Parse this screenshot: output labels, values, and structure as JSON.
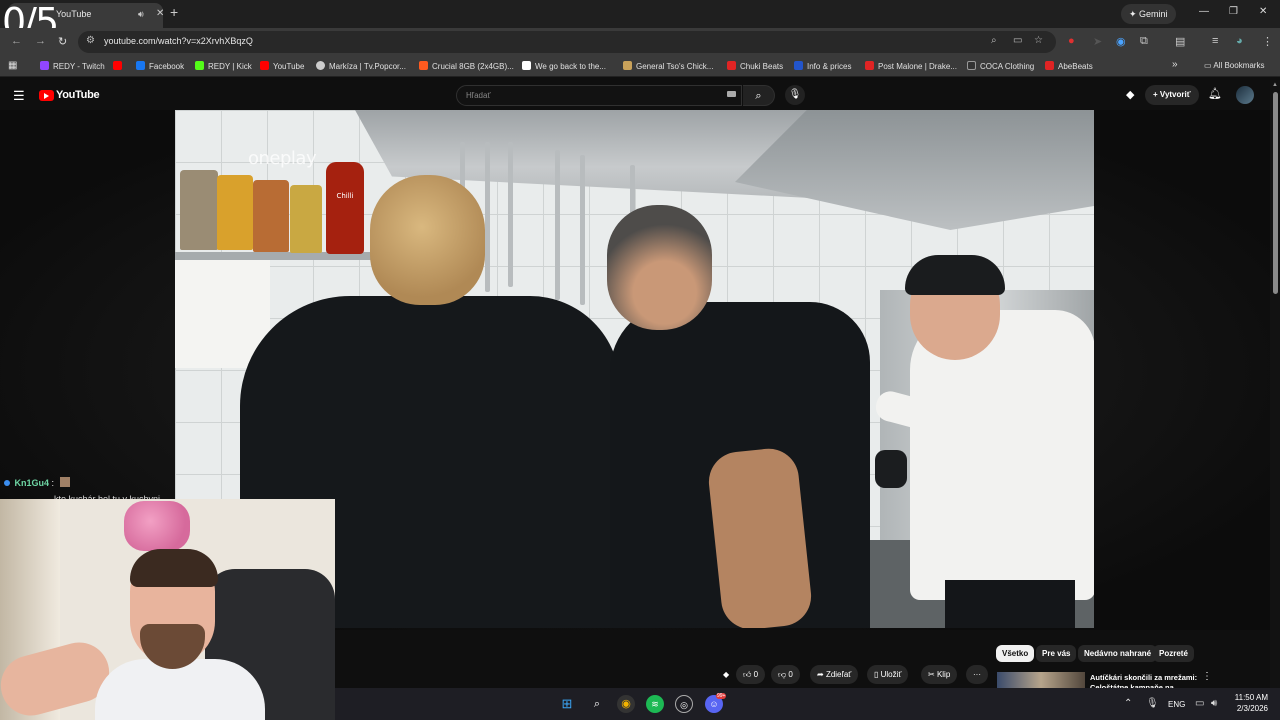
{
  "stream_counter": "0/5",
  "browser": {
    "tab_title": "YouTube",
    "gemini_label": "Gemini",
    "url": "youtube.com/watch?v=x2XrvhXBqzQ",
    "bookmarks": [
      {
        "label": "REDY - Twitch",
        "color": "#9146ff"
      },
      {
        "label": "",
        "color": "#ff0000"
      },
      {
        "label": "Facebook",
        "color": "#1877f2"
      },
      {
        "label": "REDY | Kick",
        "color": "#53fc18"
      },
      {
        "label": "YouTube",
        "color": "#ff0000"
      },
      {
        "label": "Markíza | Tv.Popcor...",
        "color": "#cccccc"
      },
      {
        "label": "Crucial 8GB (2x4GB)...",
        "color": "#ff5a1f"
      },
      {
        "label": "We go back to the...",
        "color": "#ffffff"
      },
      {
        "label": "General Tso's Chick...",
        "color": "#c9a25a"
      },
      {
        "label": "Chuki Beats",
        "color": "#e02424"
      },
      {
        "label": "Info & prices",
        "color": "#2255cc"
      },
      {
        "label": "Post Malone | Drake...",
        "color": "#e02424"
      },
      {
        "label": "COCA Clothing",
        "color": "#333333"
      },
      {
        "label": "AbeBeats",
        "color": "#e02424"
      }
    ],
    "all_bookmarks_label": "All Bookmarks"
  },
  "youtube": {
    "logo_text": "YouTube",
    "search_placeholder": "Hľadať",
    "create_label": "Vytvoriť",
    "video_watermark": "oneplay",
    "sauce_label": "Chilli",
    "actions": {
      "like_count": "0",
      "dislike_count": "0",
      "share_label": "Zdieľať",
      "save_label": "Uložiť",
      "clip_label": "Klip"
    },
    "chips": [
      "Všetko",
      "Pre vás",
      "Nedávno nahrané",
      "Pozreté"
    ],
    "recommendation_title": "Autíčkári skončili za mrežami: Celoštátne kampaňe na internete"
  },
  "chat": {
    "username": "Kn1Gu4",
    "separator": ":",
    "partial_message": "kto kuchár bol tu v kuchyni"
  },
  "taskbar": {
    "language": "ENG",
    "time": "11:50 AM",
    "date": "2/3/2026",
    "discord_badge": "99+"
  },
  "colors": {
    "youtube_red": "#ff0000",
    "background": "#0f0f0f",
    "chip_active": "#f1f1f1"
  }
}
